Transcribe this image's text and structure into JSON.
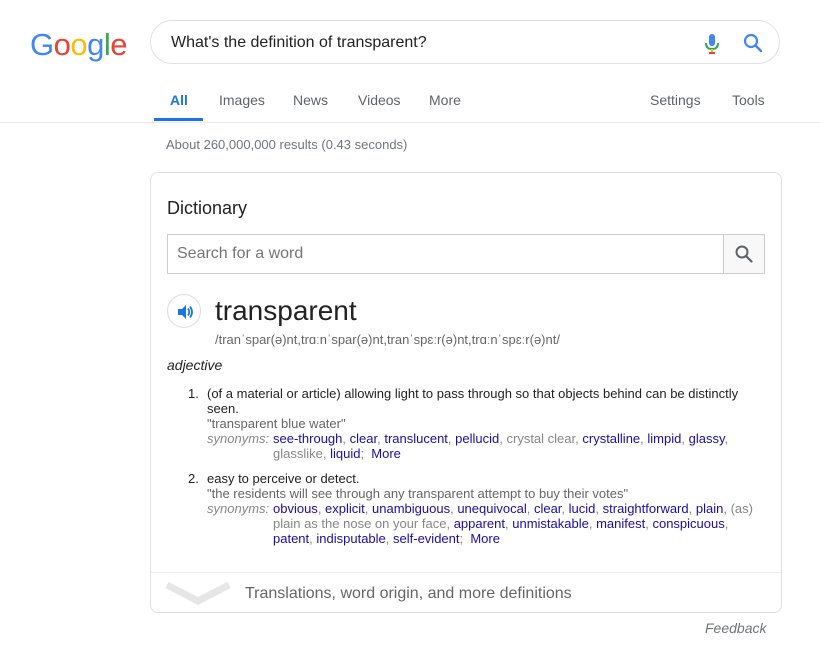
{
  "logo": {
    "letters": [
      "G",
      "o",
      "o",
      "g",
      "l",
      "e"
    ]
  },
  "search": {
    "query": "What's the definition of transparent?"
  },
  "tabs": {
    "all": "All",
    "images": "Images",
    "news": "News",
    "videos": "Videos",
    "more": "More",
    "settings": "Settings",
    "tools": "Tools"
  },
  "stats": "About 260,000,000 results (0.43 seconds)",
  "dictionary": {
    "title": "Dictionary",
    "search_placeholder": "Search for a word",
    "word": "transparent",
    "pronunciation": "/tranˈspar(ə)nt,trɑːnˈspar(ə)nt,tranˈspɛːr(ə)nt,trɑːnˈspɛːr(ə)nt/",
    "part_of_speech": "adjective",
    "senses": [
      {
        "number": "1.",
        "definition_line1": "(of a material or article) allowing light to pass through so that objects behind can be distinctly",
        "definition_line2": "seen.",
        "example": "\"transparent blue water\"",
        "synonyms_label": "synonyms:",
        "synonyms": [
          "see-through",
          "clear",
          "translucent",
          "pellucid",
          "crystal clear",
          "crystalline",
          "limpid",
          "glassy",
          "glasslike",
          "liquid"
        ],
        "more": "More"
      },
      {
        "number": "2.",
        "definition_line1": "easy to perceive or detect.",
        "example": "\"the residents will see through any transparent attempt to buy their votes\"",
        "synonyms_label": "synonyms:",
        "synonyms": [
          "obvious",
          "explicit",
          "unambiguous",
          "unequivocal",
          "clear",
          "lucid",
          "straightforward",
          "plain",
          "(as) plain as the nose on your face",
          "apparent",
          "unmistakable",
          "manifest",
          "conspicuous",
          "patent",
          "indisputable",
          "self-evident"
        ],
        "more": "More"
      }
    ],
    "more_link": "Translations, word origin, and more definitions"
  },
  "feedback": "Feedback",
  "colors": {
    "link": "#1a0dab",
    "accent": "#1a73e8",
    "muted": "#70757a"
  },
  "icons": [
    "mic-icon",
    "search-icon",
    "speaker-icon",
    "chevron-down-icon"
  ]
}
